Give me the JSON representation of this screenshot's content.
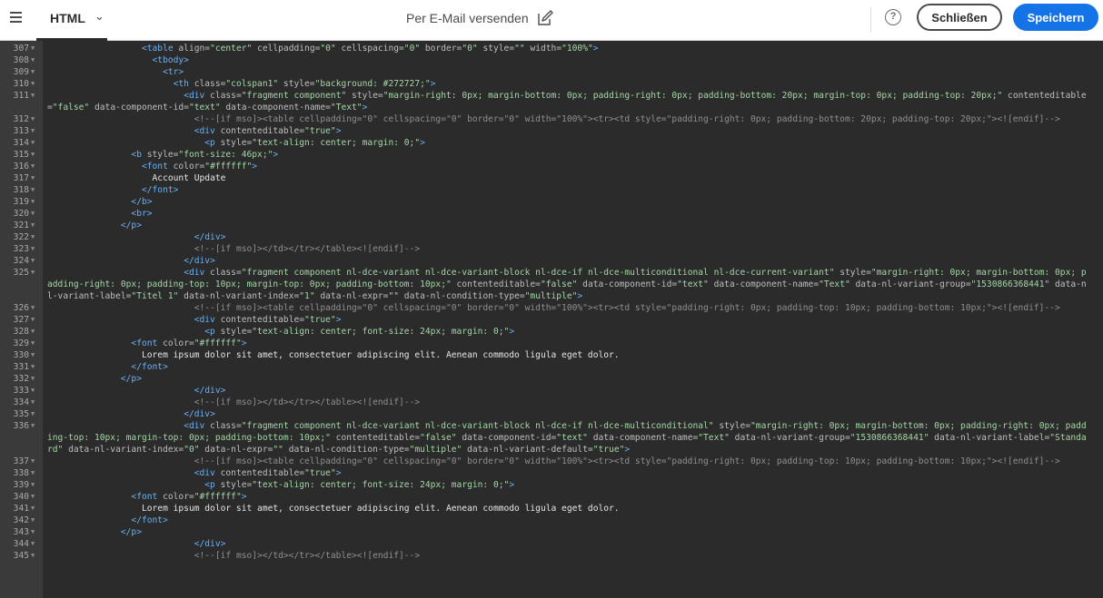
{
  "header": {
    "mode_label": "HTML",
    "title": "Per E-Mail versenden",
    "help_symbol": "?",
    "close_label": "Schließen",
    "save_label": "Speichern",
    "icons": {
      "menu": "hamburger-icon",
      "mode_dropdown": "chevron-down-icon",
      "edit_title": "edit-icon",
      "help": "help-icon"
    }
  },
  "editor": {
    "lines": [
      {
        "n": "307",
        "segs": [
          [
            "s",
            "                  "
          ],
          [
            "t",
            "<table"
          ],
          [
            "a",
            " align="
          ],
          [
            "v",
            "\"center\""
          ],
          [
            "a",
            " cellpadding="
          ],
          [
            "v",
            "\"0\""
          ],
          [
            "a",
            " cellspacing="
          ],
          [
            "v",
            "\"0\""
          ],
          [
            "a",
            " border="
          ],
          [
            "v",
            "\"0\""
          ],
          [
            "a",
            " style="
          ],
          [
            "v",
            "\"\""
          ],
          [
            "a",
            " width="
          ],
          [
            "v",
            "\"100%\""
          ],
          [
            "t",
            ">"
          ]
        ]
      },
      {
        "n": "308",
        "segs": [
          [
            "s",
            "                    "
          ],
          [
            "t",
            "<tbody>"
          ]
        ]
      },
      {
        "n": "309",
        "segs": [
          [
            "s",
            "                      "
          ],
          [
            "t",
            "<tr>"
          ]
        ]
      },
      {
        "n": "310",
        "segs": [
          [
            "s",
            "                        "
          ],
          [
            "t",
            "<th"
          ],
          [
            "a",
            " class="
          ],
          [
            "v",
            "\"colspan1\""
          ],
          [
            "a",
            " style="
          ],
          [
            "v",
            "\"background: #272727;\""
          ],
          [
            "t",
            ">"
          ]
        ]
      },
      {
        "n": "311",
        "segs": [
          [
            "s",
            "                          "
          ],
          [
            "t",
            "<div"
          ],
          [
            "a",
            " class="
          ],
          [
            "v",
            "\"fragment component\""
          ],
          [
            "a",
            " style="
          ],
          [
            "v",
            "\"margin-right: 0px; margin-bottom: 0px; padding-right: 0px; padding-bottom: 20px; margin-top: 0px; padding-top: 20px;\""
          ],
          [
            "a",
            " contenteditable="
          ],
          [
            "v",
            "\"false\""
          ],
          [
            "a",
            " data-component-id="
          ],
          [
            "v",
            "\"text\""
          ],
          [
            "a",
            " data-component-name="
          ],
          [
            "v",
            "\"Text\""
          ],
          [
            "t",
            ">"
          ]
        ]
      },
      {
        "n": "312",
        "segs": [
          [
            "s",
            "                            "
          ],
          [
            "c",
            "<!--[if mso]><table cellpadding=\"0\" cellspacing=\"0\" border=\"0\" width=\"100%\"><tr><td style=\"padding-right: 0px; padding-bottom: 20px; padding-top: 20px;\"><![endif]-->"
          ]
        ]
      },
      {
        "n": "313",
        "segs": [
          [
            "s",
            "                            "
          ],
          [
            "t",
            "<div"
          ],
          [
            "a",
            " contenteditable="
          ],
          [
            "v",
            "\"true\""
          ],
          [
            "t",
            ">"
          ]
        ]
      },
      {
        "n": "314",
        "segs": [
          [
            "s",
            "                              "
          ],
          [
            "t",
            "<p"
          ],
          [
            "a",
            " style="
          ],
          [
            "v",
            "\"text-align: center; margin: 0;\""
          ],
          [
            "t",
            ">"
          ]
        ]
      },
      {
        "n": "315",
        "segs": [
          [
            "s",
            "                "
          ],
          [
            "t",
            "<b"
          ],
          [
            "a",
            " style="
          ],
          [
            "v",
            "\"font-size: 46px;\""
          ],
          [
            "t",
            ">"
          ]
        ]
      },
      {
        "n": "316",
        "segs": [
          [
            "s",
            "                  "
          ],
          [
            "t",
            "<font"
          ],
          [
            "a",
            " color="
          ],
          [
            "v",
            "\"#ffffff\""
          ],
          [
            "t",
            ">"
          ]
        ]
      },
      {
        "n": "317",
        "segs": [
          [
            "s",
            "                    "
          ],
          [
            "x",
            "Account Update"
          ]
        ]
      },
      {
        "n": "318",
        "segs": [
          [
            "s",
            "                  "
          ],
          [
            "t",
            "</font>"
          ]
        ]
      },
      {
        "n": "319",
        "segs": [
          [
            "s",
            "                "
          ],
          [
            "t",
            "</b>"
          ]
        ]
      },
      {
        "n": "320",
        "segs": [
          [
            "s",
            "                "
          ],
          [
            "t",
            "<br>"
          ]
        ]
      },
      {
        "n": "321",
        "segs": [
          [
            "s",
            "              "
          ],
          [
            "t",
            "</p>"
          ]
        ]
      },
      {
        "n": "322",
        "segs": [
          [
            "s",
            "                            "
          ],
          [
            "t",
            "</div>"
          ]
        ]
      },
      {
        "n": "323",
        "segs": [
          [
            "s",
            "                            "
          ],
          [
            "c",
            "<!--[if mso]></td></tr></table><![endif]-->"
          ]
        ]
      },
      {
        "n": "324",
        "segs": [
          [
            "s",
            "                          "
          ],
          [
            "t",
            "</div>"
          ]
        ]
      },
      {
        "n": "325",
        "segs": [
          [
            "s",
            "                          "
          ],
          [
            "t",
            "<div"
          ],
          [
            "a",
            " class="
          ],
          [
            "v",
            "\"fragment component nl-dce-variant nl-dce-variant-block nl-dce-if nl-dce-multiconditional nl-dce-current-variant\""
          ],
          [
            "a",
            " style="
          ],
          [
            "v",
            "\"margin-right: 0px; margin-bottom: 0px; padding-right: 0px; padding-top: 10px; margin-top: 0px; padding-bottom: 10px;\""
          ],
          [
            "a",
            " contenteditable="
          ],
          [
            "v",
            "\"false\""
          ],
          [
            "a",
            " data-component-id="
          ],
          [
            "v",
            "\"text\""
          ],
          [
            "a",
            " data-component-name="
          ],
          [
            "v",
            "\"Text\""
          ],
          [
            "a",
            " data-nl-variant-group="
          ],
          [
            "v",
            "\"1530866368441\""
          ],
          [
            "a",
            " data-nl-variant-label="
          ],
          [
            "v",
            "\"Titel 1\""
          ],
          [
            "a",
            " data-nl-variant-index="
          ],
          [
            "v",
            "\"1\""
          ],
          [
            "a",
            " data-nl-expr="
          ],
          [
            "v",
            "\"\""
          ],
          [
            "a",
            " data-nl-condition-type="
          ],
          [
            "v",
            "\"multiple\""
          ],
          [
            "t",
            ">"
          ]
        ]
      },
      {
        "n": "326",
        "segs": [
          [
            "s",
            "                            "
          ],
          [
            "c",
            "<!--[if mso]><table cellpadding=\"0\" cellspacing=\"0\" border=\"0\" width=\"100%\"><tr><td style=\"padding-right: 0px; padding-top: 10px; padding-bottom: 10px;\"><![endif]-->"
          ]
        ]
      },
      {
        "n": "327",
        "segs": [
          [
            "s",
            "                            "
          ],
          [
            "t",
            "<div"
          ],
          [
            "a",
            " contenteditable="
          ],
          [
            "v",
            "\"true\""
          ],
          [
            "t",
            ">"
          ]
        ]
      },
      {
        "n": "328",
        "segs": [
          [
            "s",
            "                              "
          ],
          [
            "t",
            "<p"
          ],
          [
            "a",
            " style="
          ],
          [
            "v",
            "\"text-align: center; font-size: 24px; margin: 0;\""
          ],
          [
            "t",
            ">"
          ]
        ]
      },
      {
        "n": "329",
        "segs": [
          [
            "s",
            "                "
          ],
          [
            "t",
            "<font"
          ],
          [
            "a",
            " color="
          ],
          [
            "v",
            "\"#ffffff\""
          ],
          [
            "t",
            ">"
          ]
        ]
      },
      {
        "n": "330",
        "segs": [
          [
            "s",
            "                  "
          ],
          [
            "x",
            "Lorem ipsum dolor sit amet, consectetuer adipiscing elit. Aenean commodo ligula eget dolor."
          ]
        ]
      },
      {
        "n": "331",
        "segs": [
          [
            "s",
            "                "
          ],
          [
            "t",
            "</font>"
          ]
        ]
      },
      {
        "n": "332",
        "segs": [
          [
            "s",
            "              "
          ],
          [
            "t",
            "</p>"
          ]
        ]
      },
      {
        "n": "333",
        "segs": [
          [
            "s",
            "                            "
          ],
          [
            "t",
            "</div>"
          ]
        ]
      },
      {
        "n": "334",
        "segs": [
          [
            "s",
            "                            "
          ],
          [
            "c",
            "<!--[if mso]></td></tr></table><![endif]-->"
          ]
        ]
      },
      {
        "n": "335",
        "segs": [
          [
            "s",
            "                          "
          ],
          [
            "t",
            "</div>"
          ]
        ]
      },
      {
        "n": "336",
        "segs": [
          [
            "s",
            "                          "
          ],
          [
            "t",
            "<div"
          ],
          [
            "a",
            " class="
          ],
          [
            "v",
            "\"fragment component nl-dce-variant nl-dce-variant-block nl-dce-if nl-dce-multiconditional\""
          ],
          [
            "a",
            " style="
          ],
          [
            "v",
            "\"margin-right: 0px; margin-bottom: 0px; padding-right: 0px; padding-top: 10px; margin-top: 0px; padding-bottom: 10px;\""
          ],
          [
            "a",
            " contenteditable="
          ],
          [
            "v",
            "\"false\""
          ],
          [
            "a",
            " data-component-id="
          ],
          [
            "v",
            "\"text\""
          ],
          [
            "a",
            " data-component-name="
          ],
          [
            "v",
            "\"Text\""
          ],
          [
            "a",
            " data-nl-variant-group="
          ],
          [
            "v",
            "\"1530866368441\""
          ],
          [
            "a",
            " data-nl-variant-label="
          ],
          [
            "v",
            "\"Standard\""
          ],
          [
            "a",
            " data-nl-variant-index="
          ],
          [
            "v",
            "\"0\""
          ],
          [
            "a",
            " data-nl-expr="
          ],
          [
            "v",
            "\"\""
          ],
          [
            "a",
            " data-nl-condition-type="
          ],
          [
            "v",
            "\"multiple\""
          ],
          [
            "a",
            " data-nl-variant-default="
          ],
          [
            "v",
            "\"true\""
          ],
          [
            "t",
            ">"
          ]
        ]
      },
      {
        "n": "337",
        "segs": [
          [
            "s",
            "                            "
          ],
          [
            "c",
            "<!--[if mso]><table cellpadding=\"0\" cellspacing=\"0\" border=\"0\" width=\"100%\"><tr><td style=\"padding-right: 0px; padding-top: 10px; padding-bottom: 10px;\"><![endif]-->"
          ]
        ]
      },
      {
        "n": "338",
        "segs": [
          [
            "s",
            "                            "
          ],
          [
            "t",
            "<div"
          ],
          [
            "a",
            " contenteditable="
          ],
          [
            "v",
            "\"true\""
          ],
          [
            "t",
            ">"
          ]
        ]
      },
      {
        "n": "339",
        "segs": [
          [
            "s",
            "                              "
          ],
          [
            "t",
            "<p"
          ],
          [
            "a",
            " style="
          ],
          [
            "v",
            "\"text-align: center; font-size: 24px; margin: 0;\""
          ],
          [
            "t",
            ">"
          ]
        ]
      },
      {
        "n": "340",
        "segs": [
          [
            "s",
            "                "
          ],
          [
            "t",
            "<font"
          ],
          [
            "a",
            " color="
          ],
          [
            "v",
            "\"#ffffff\""
          ],
          [
            "t",
            ">"
          ]
        ]
      },
      {
        "n": "341",
        "segs": [
          [
            "s",
            "                  "
          ],
          [
            "x",
            "Lorem ipsum dolor sit amet, consectetuer adipiscing elit. Aenean commodo ligula eget dolor."
          ]
        ]
      },
      {
        "n": "342",
        "segs": [
          [
            "s",
            "                "
          ],
          [
            "t",
            "</font>"
          ]
        ]
      },
      {
        "n": "343",
        "segs": [
          [
            "s",
            "              "
          ],
          [
            "t",
            "</p>"
          ]
        ]
      },
      {
        "n": "344",
        "segs": [
          [
            "s",
            "                            "
          ],
          [
            "t",
            "</div>"
          ]
        ]
      },
      {
        "n": "345",
        "segs": [
          [
            "s",
            "                            "
          ],
          [
            "c",
            "<!--[if mso]></td></tr></table><![endif]-->"
          ]
        ]
      }
    ]
  }
}
